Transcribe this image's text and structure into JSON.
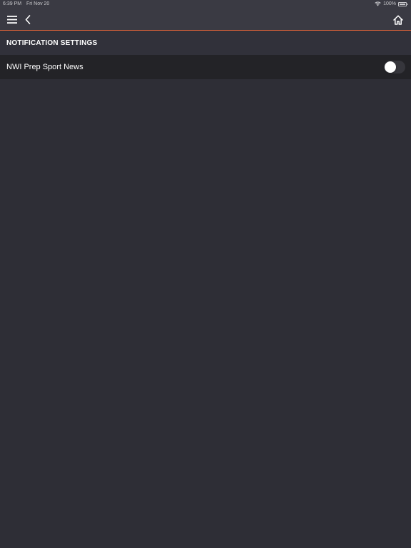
{
  "status_bar": {
    "time": "6:39 PM",
    "date": "Fri Nov 20",
    "battery": "100%"
  },
  "nav": {
    "menu_icon": "hamburger-menu-icon",
    "back_icon": "chevron-left-icon",
    "home_icon": "home-icon",
    "accent_color": "#d9613a"
  },
  "section": {
    "title": "NOTIFICATION SETTINGS"
  },
  "settings": [
    {
      "label": "NWI Prep Sport News",
      "enabled": false
    }
  ]
}
